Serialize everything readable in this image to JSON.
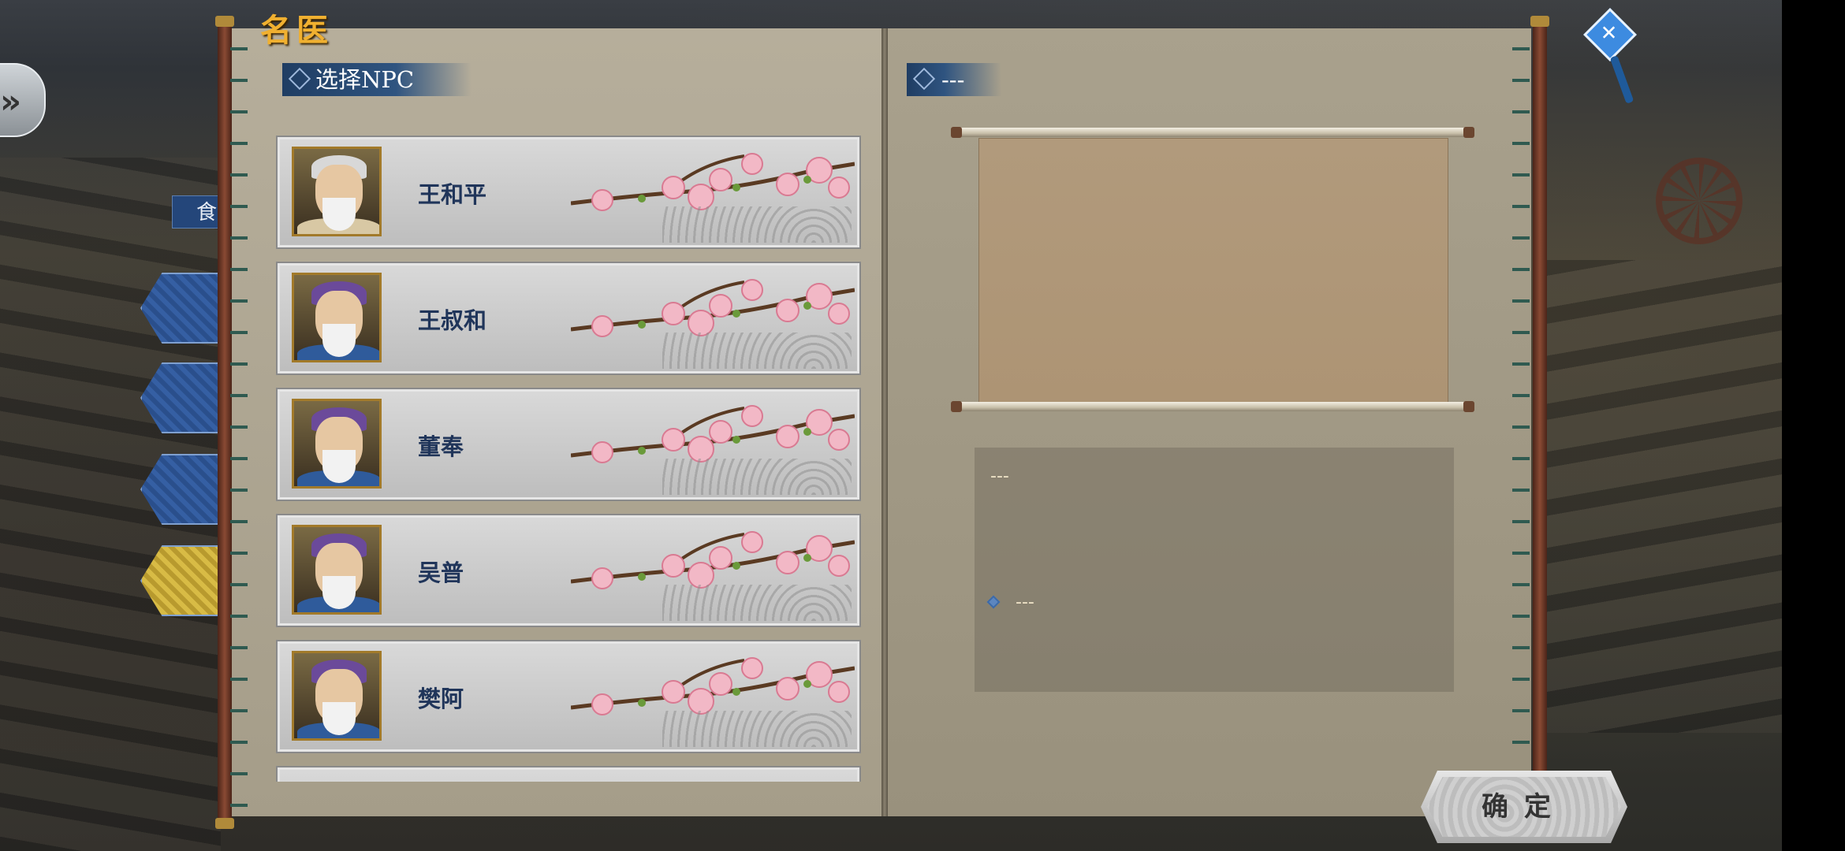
{
  "window": {
    "title": "名医"
  },
  "left_panel": {
    "header": "选择NPC"
  },
  "npcs": [
    {
      "name": "王和平"
    },
    {
      "name": "王叔和"
    },
    {
      "name": "董奉"
    },
    {
      "name": "吴普"
    },
    {
      "name": "樊阿"
    }
  ],
  "right_panel": {
    "header": "---",
    "info_line1": "---",
    "info_line2": "---"
  },
  "side": {
    "food_tab": "食",
    "back_icon": "double-chevron-right-icon"
  },
  "buttons": {
    "confirm": "确定"
  },
  "colors": {
    "title": "#f0b030",
    "npc_name": "#20355a",
    "header_bg": "#2f5480",
    "scroll_paper": "#b19a7c"
  }
}
